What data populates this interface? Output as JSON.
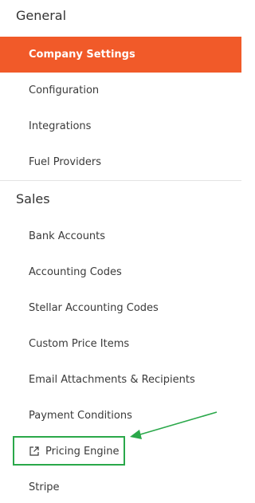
{
  "sections": [
    {
      "title": "General",
      "items": [
        {
          "label": "Company Settings",
          "active": true
        },
        {
          "label": "Configuration"
        },
        {
          "label": "Integrations"
        },
        {
          "label": "Fuel Providers"
        }
      ]
    },
    {
      "title": "Sales",
      "items": [
        {
          "label": "Bank Accounts"
        },
        {
          "label": "Accounting Codes"
        },
        {
          "label": "Stellar Accounting Codes"
        },
        {
          "label": "Custom Price Items"
        },
        {
          "label": "Email Attachments & Recipients"
        },
        {
          "label": "Payment Conditions"
        },
        {
          "label": "Pricing Engine",
          "icon": "external-link-icon",
          "external": true
        },
        {
          "label": "Stripe"
        }
      ]
    }
  ],
  "colors": {
    "active_background": "#f15a29",
    "active_text": "#ffffff",
    "annotation": "#2aa84a",
    "text": "#3a3a3a",
    "divider": "#e3e3e3"
  }
}
